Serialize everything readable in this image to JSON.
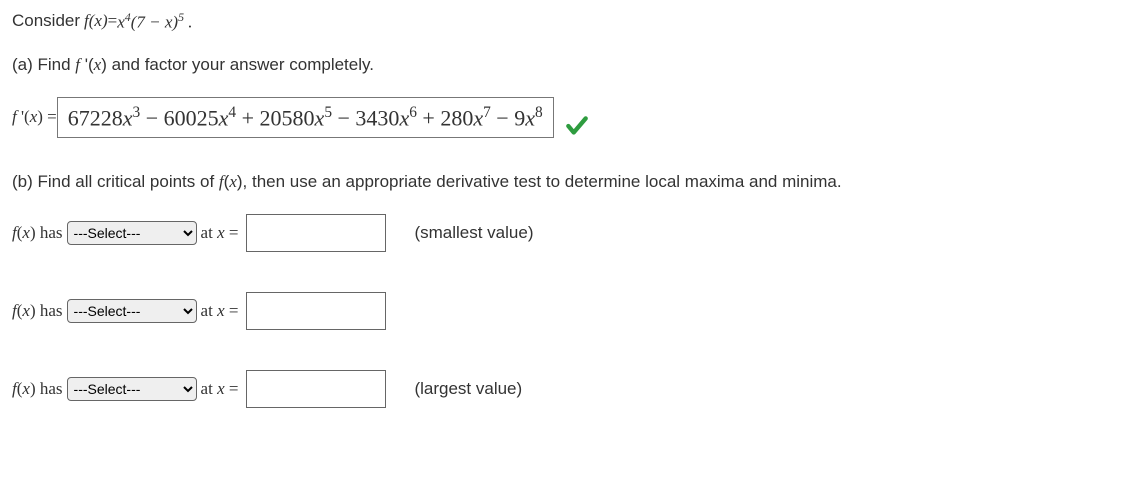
{
  "intro": {
    "consider": "Consider",
    "fx": "f(x)",
    "eq": " = ",
    "expr_html": "x<sup>4</sup>(7 − x)<sup>5</sup> ."
  },
  "partA": {
    "label_html": "(a) Find <span class='math-i'>f</span> '(<span class='math-i'>x</span>) and factor your answer completely.",
    "lead_html": "<span class='math-i'>f</span> '(<span class='math-i'>x</span>) = ",
    "answer_html": "67228<span class='math-i'>x</span><sup>3</sup> − 60025<span class='math-i'>x</span><sup>4</sup> + 20580<span class='math-i'>x</span><sup>5</sup> − 3430<span class='math-i'>x</span><sup>6</sup> + 280<span class='math-i'>x</span><sup>7</sup> − 9<span class='math-i'>x</span><sup>8</sup>",
    "status": "correct"
  },
  "partB": {
    "label_html": "(b) Find all critical points of <span class='math-i'>f</span>(<span class='math-i'>x</span>), then use an appropriate derivative test to determine local maxima and minima."
  },
  "dropdown_placeholder": "---Select---",
  "cp": [
    {
      "lead_html": "<span class='math-i'>f</span>(<span class='math-i'>x</span>) has",
      "at_html": "at <span class='math-i'>x</span> =",
      "trail": "(smallest value)"
    },
    {
      "lead_html": "<span class='math-i'>f</span>(<span class='math-i'>x</span>) has",
      "at_html": "at <span class='math-i'>x</span> =",
      "trail": ""
    },
    {
      "lead_html": "<span class='math-i'>f</span>(<span class='math-i'>x</span>) has",
      "at_html": "at <span class='math-i'>x</span> =",
      "trail": "(largest value)"
    }
  ]
}
